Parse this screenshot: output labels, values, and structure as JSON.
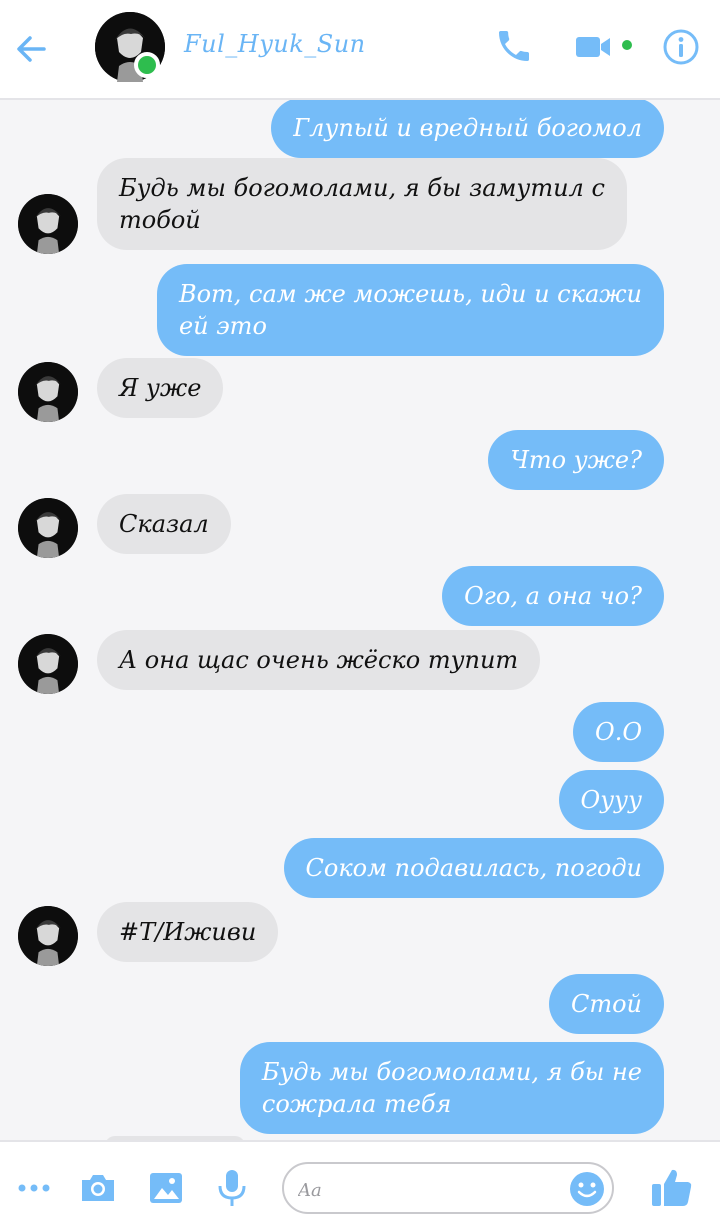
{
  "header": {
    "contact_name": "Ful_Hyuk_Sun"
  },
  "messages": [
    {
      "dir": "out",
      "text": "Глупый и вредный богомол"
    },
    {
      "dir": "in",
      "text": "Будь мы богомолами, я бы замутил с\nтобой"
    },
    {
      "dir": "out",
      "text": "Вот, сам же можешь, иди и скажи\nей это"
    },
    {
      "dir": "in",
      "text": "Я уже"
    },
    {
      "dir": "out",
      "text": "Что уже?"
    },
    {
      "dir": "in",
      "text": "Сказал"
    },
    {
      "dir": "out",
      "text": "Ого, а она чо?"
    },
    {
      "dir": "in",
      "text": "А она щас очень жёско тупит"
    },
    {
      "dir": "out",
      "text": "О.О"
    },
    {
      "dir": "out",
      "text": "Оууу"
    },
    {
      "dir": "out",
      "text": "Соком подавилась, погоди"
    },
    {
      "dir": "in",
      "text": "#Т/Иживи"
    },
    {
      "dir": "out",
      "text": "Стой"
    },
    {
      "dir": "out",
      "text": "Будь мы богомолами, я бы не\nсожрала тебя"
    }
  ],
  "composer": {
    "placeholder": "Aa"
  },
  "colors": {
    "accent": "#6ab5f5",
    "outgoing_bubble": "#75bcf8",
    "incoming_bubble": "#e4e4e6",
    "online": "#2ebd4e"
  },
  "icons": [
    "back-arrow-icon",
    "phone-icon",
    "video-camera-icon",
    "info-icon",
    "more-icon",
    "camera-icon",
    "image-icon",
    "microphone-icon",
    "emoji-icon",
    "thumbs-up-icon"
  ]
}
